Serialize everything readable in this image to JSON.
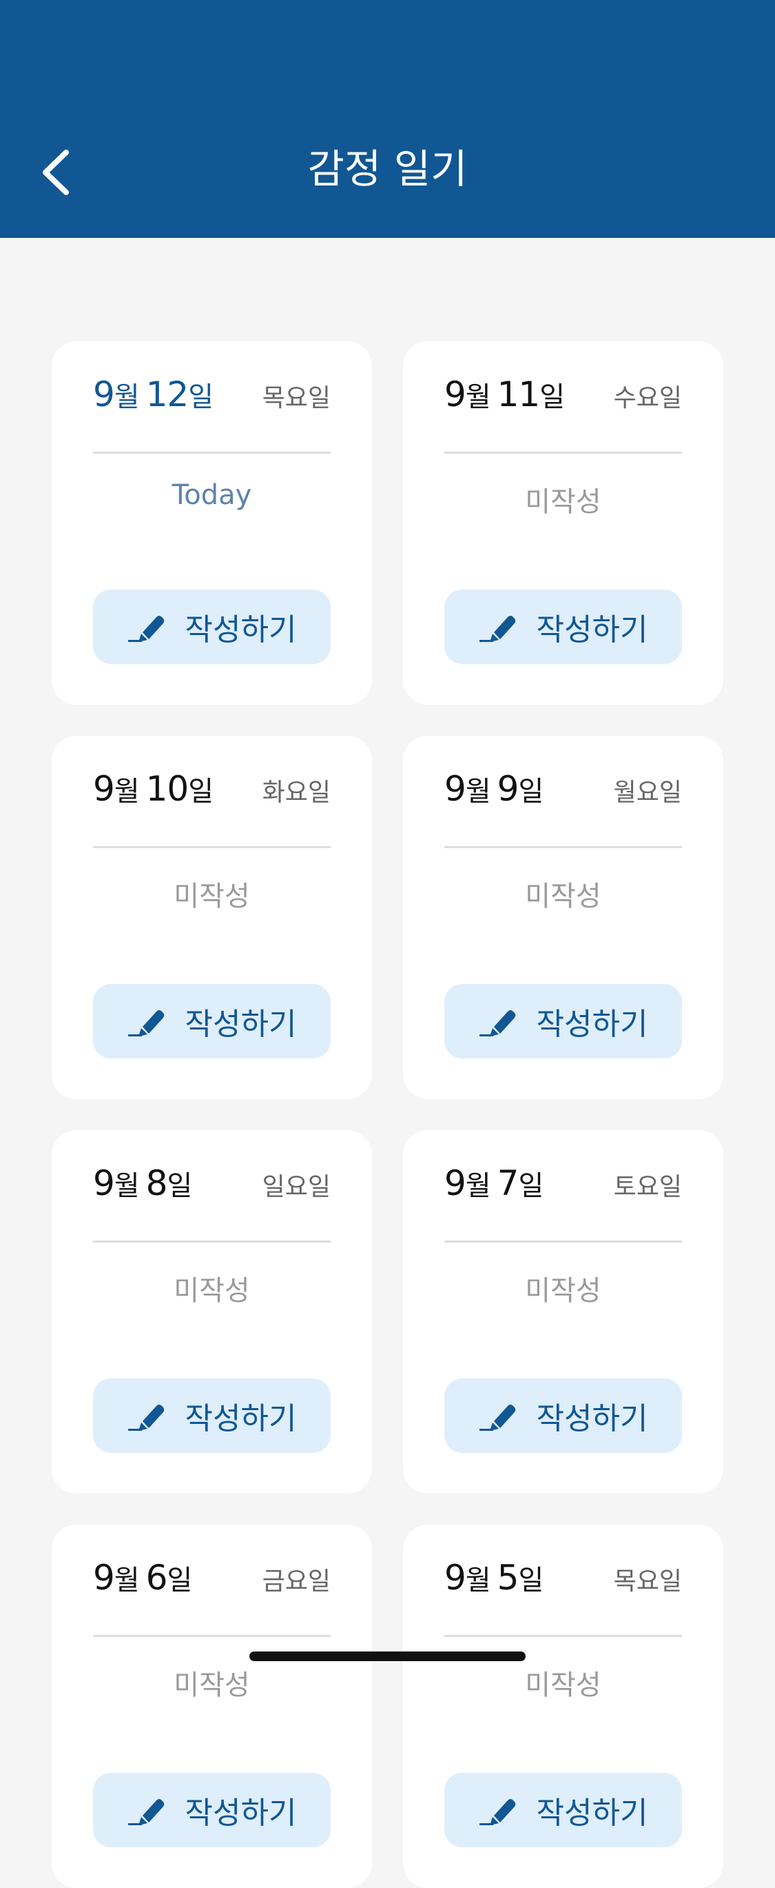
{
  "header": {
    "title": "감정 일기",
    "back_icon": "chevron-left-icon"
  },
  "colors": {
    "header_bg": "#115793",
    "page_bg": "#f5f5f5",
    "button_bg": "#dfeefb",
    "accent": "#115793"
  },
  "cards": [
    {
      "month": "9",
      "month_unit": "월",
      "day": "12",
      "day_unit": "일",
      "weekday": "목요일",
      "status": "Today",
      "button_label": "작성하기",
      "today": true
    },
    {
      "month": "9",
      "month_unit": "월",
      "day": "11",
      "day_unit": "일",
      "weekday": "수요일",
      "status": "미작성",
      "button_label": "작성하기",
      "today": false
    },
    {
      "month": "9",
      "month_unit": "월",
      "day": "10",
      "day_unit": "일",
      "weekday": "화요일",
      "status": "미작성",
      "button_label": "작성하기",
      "today": false
    },
    {
      "month": "9",
      "month_unit": "월",
      "day": "9",
      "day_unit": "일",
      "weekday": "월요일",
      "status": "미작성",
      "button_label": "작성하기",
      "today": false
    },
    {
      "month": "9",
      "month_unit": "월",
      "day": "8",
      "day_unit": "일",
      "weekday": "일요일",
      "status": "미작성",
      "button_label": "작성하기",
      "today": false
    },
    {
      "month": "9",
      "month_unit": "월",
      "day": "7",
      "day_unit": "일",
      "weekday": "토요일",
      "status": "미작성",
      "button_label": "작성하기",
      "today": false
    },
    {
      "month": "9",
      "month_unit": "월",
      "day": "6",
      "day_unit": "일",
      "weekday": "금요일",
      "status": "미작성",
      "button_label": "작성하기",
      "today": false
    },
    {
      "month": "9",
      "month_unit": "월",
      "day": "5",
      "day_unit": "일",
      "weekday": "목요일",
      "status": "미작성",
      "button_label": "작성하기",
      "today": false
    }
  ],
  "icons": {
    "write_button_icon": "pencil-icon"
  }
}
